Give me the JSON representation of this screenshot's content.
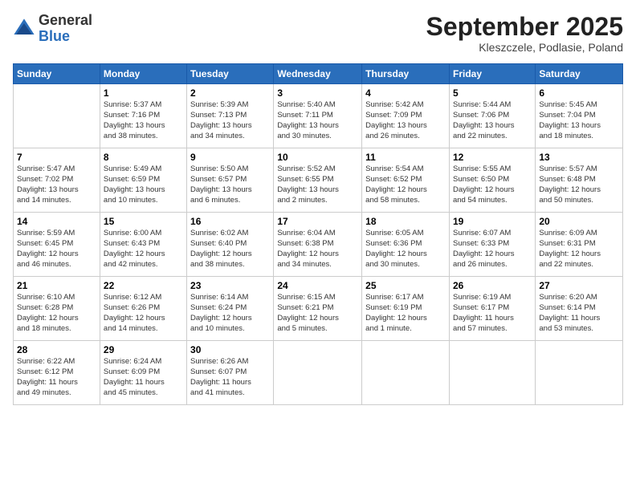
{
  "logo": {
    "general": "General",
    "blue": "Blue"
  },
  "header": {
    "month": "September 2025",
    "location": "Kleszczele, Podlasie, Poland"
  },
  "weekdays": [
    "Sunday",
    "Monday",
    "Tuesday",
    "Wednesday",
    "Thursday",
    "Friday",
    "Saturday"
  ],
  "weeks": [
    [
      {
        "day": "",
        "info": ""
      },
      {
        "day": "1",
        "info": "Sunrise: 5:37 AM\nSunset: 7:16 PM\nDaylight: 13 hours\nand 38 minutes."
      },
      {
        "day": "2",
        "info": "Sunrise: 5:39 AM\nSunset: 7:13 PM\nDaylight: 13 hours\nand 34 minutes."
      },
      {
        "day": "3",
        "info": "Sunrise: 5:40 AM\nSunset: 7:11 PM\nDaylight: 13 hours\nand 30 minutes."
      },
      {
        "day": "4",
        "info": "Sunrise: 5:42 AM\nSunset: 7:09 PM\nDaylight: 13 hours\nand 26 minutes."
      },
      {
        "day": "5",
        "info": "Sunrise: 5:44 AM\nSunset: 7:06 PM\nDaylight: 13 hours\nand 22 minutes."
      },
      {
        "day": "6",
        "info": "Sunrise: 5:45 AM\nSunset: 7:04 PM\nDaylight: 13 hours\nand 18 minutes."
      }
    ],
    [
      {
        "day": "7",
        "info": "Sunrise: 5:47 AM\nSunset: 7:02 PM\nDaylight: 13 hours\nand 14 minutes."
      },
      {
        "day": "8",
        "info": "Sunrise: 5:49 AM\nSunset: 6:59 PM\nDaylight: 13 hours\nand 10 minutes."
      },
      {
        "day": "9",
        "info": "Sunrise: 5:50 AM\nSunset: 6:57 PM\nDaylight: 13 hours\nand 6 minutes."
      },
      {
        "day": "10",
        "info": "Sunrise: 5:52 AM\nSunset: 6:55 PM\nDaylight: 13 hours\nand 2 minutes."
      },
      {
        "day": "11",
        "info": "Sunrise: 5:54 AM\nSunset: 6:52 PM\nDaylight: 12 hours\nand 58 minutes."
      },
      {
        "day": "12",
        "info": "Sunrise: 5:55 AM\nSunset: 6:50 PM\nDaylight: 12 hours\nand 54 minutes."
      },
      {
        "day": "13",
        "info": "Sunrise: 5:57 AM\nSunset: 6:48 PM\nDaylight: 12 hours\nand 50 minutes."
      }
    ],
    [
      {
        "day": "14",
        "info": "Sunrise: 5:59 AM\nSunset: 6:45 PM\nDaylight: 12 hours\nand 46 minutes."
      },
      {
        "day": "15",
        "info": "Sunrise: 6:00 AM\nSunset: 6:43 PM\nDaylight: 12 hours\nand 42 minutes."
      },
      {
        "day": "16",
        "info": "Sunrise: 6:02 AM\nSunset: 6:40 PM\nDaylight: 12 hours\nand 38 minutes."
      },
      {
        "day": "17",
        "info": "Sunrise: 6:04 AM\nSunset: 6:38 PM\nDaylight: 12 hours\nand 34 minutes."
      },
      {
        "day": "18",
        "info": "Sunrise: 6:05 AM\nSunset: 6:36 PM\nDaylight: 12 hours\nand 30 minutes."
      },
      {
        "day": "19",
        "info": "Sunrise: 6:07 AM\nSunset: 6:33 PM\nDaylight: 12 hours\nand 26 minutes."
      },
      {
        "day": "20",
        "info": "Sunrise: 6:09 AM\nSunset: 6:31 PM\nDaylight: 12 hours\nand 22 minutes."
      }
    ],
    [
      {
        "day": "21",
        "info": "Sunrise: 6:10 AM\nSunset: 6:28 PM\nDaylight: 12 hours\nand 18 minutes."
      },
      {
        "day": "22",
        "info": "Sunrise: 6:12 AM\nSunset: 6:26 PM\nDaylight: 12 hours\nand 14 minutes."
      },
      {
        "day": "23",
        "info": "Sunrise: 6:14 AM\nSunset: 6:24 PM\nDaylight: 12 hours\nand 10 minutes."
      },
      {
        "day": "24",
        "info": "Sunrise: 6:15 AM\nSunset: 6:21 PM\nDaylight: 12 hours\nand 5 minutes."
      },
      {
        "day": "25",
        "info": "Sunrise: 6:17 AM\nSunset: 6:19 PM\nDaylight: 12 hours\nand 1 minute."
      },
      {
        "day": "26",
        "info": "Sunrise: 6:19 AM\nSunset: 6:17 PM\nDaylight: 11 hours\nand 57 minutes."
      },
      {
        "day": "27",
        "info": "Sunrise: 6:20 AM\nSunset: 6:14 PM\nDaylight: 11 hours\nand 53 minutes."
      }
    ],
    [
      {
        "day": "28",
        "info": "Sunrise: 6:22 AM\nSunset: 6:12 PM\nDaylight: 11 hours\nand 49 minutes."
      },
      {
        "day": "29",
        "info": "Sunrise: 6:24 AM\nSunset: 6:09 PM\nDaylight: 11 hours\nand 45 minutes."
      },
      {
        "day": "30",
        "info": "Sunrise: 6:26 AM\nSunset: 6:07 PM\nDaylight: 11 hours\nand 41 minutes."
      },
      {
        "day": "",
        "info": ""
      },
      {
        "day": "",
        "info": ""
      },
      {
        "day": "",
        "info": ""
      },
      {
        "day": "",
        "info": ""
      }
    ]
  ]
}
